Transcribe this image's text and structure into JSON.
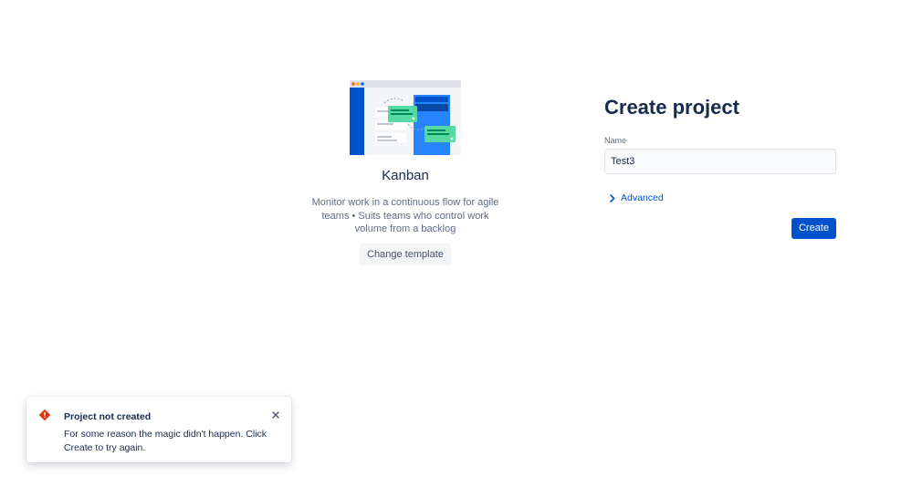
{
  "template": {
    "illustration_icon": "kanban-board-illustration",
    "name": "Kanban",
    "description": "Monitor work in a continuous flow for agile teams • Suits teams who control work volume from a backlog",
    "change_template_label": "Change template"
  },
  "form": {
    "title": "Create project",
    "name_label": "Name",
    "name_value": "Test3",
    "advanced_label": "Advanced",
    "advanced_icon": "chevron-right-icon",
    "create_label": "Create"
  },
  "flag": {
    "icon": "error-icon",
    "title": "Project not created",
    "message": "For some reason the magic didn't happen. Click Create to try again.",
    "close_icon": "close-icon"
  },
  "colors": {
    "primary": "#0052CC",
    "text": "#172B4D",
    "subtle_text": "#5E6C84",
    "error": "#DE350B"
  }
}
